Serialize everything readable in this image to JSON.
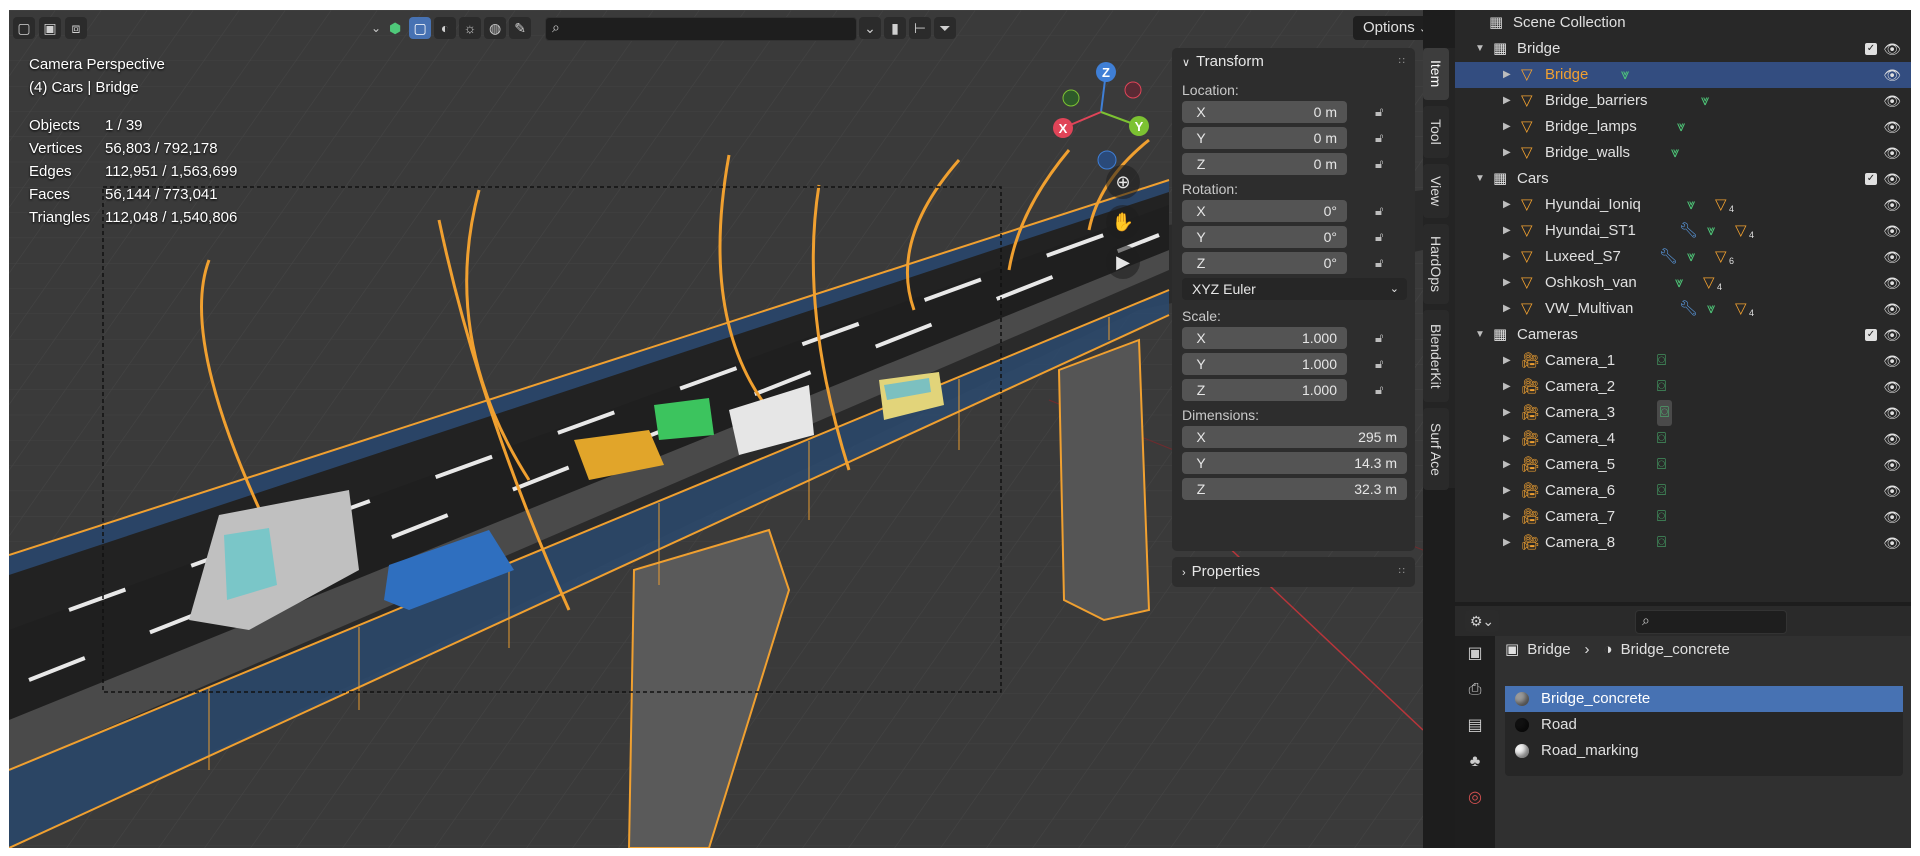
{
  "viewport": {
    "mode_label": "Camera Perspective",
    "collection_label": "(4) Cars | Bridge",
    "stats": [
      {
        "label": "Objects",
        "value": "1 / 39"
      },
      {
        "label": "Vertices",
        "value": "56,803 / 792,178"
      },
      {
        "label": "Edges",
        "value": "112,951 / 1,563,699"
      },
      {
        "label": "Faces",
        "value": "56,144 / 773,041"
      },
      {
        "label": "Triangles",
        "value": "112,048 / 1,540,806"
      }
    ],
    "options_label": "Options",
    "gizmo": {
      "x": "X",
      "y": "Y",
      "z": "Z"
    }
  },
  "npanel": {
    "transform_title": "Transform",
    "location_label": "Location:",
    "location": [
      {
        "axis": "X",
        "value": "0 m"
      },
      {
        "axis": "Y",
        "value": "0 m"
      },
      {
        "axis": "Z",
        "value": "0 m"
      }
    ],
    "rotation_label": "Rotation:",
    "rotation": [
      {
        "axis": "X",
        "value": "0°"
      },
      {
        "axis": "Y",
        "value": "0°"
      },
      {
        "axis": "Z",
        "value": "0°"
      }
    ],
    "rotation_mode": "XYZ Euler",
    "scale_label": "Scale:",
    "scale": [
      {
        "axis": "X",
        "value": "1.000"
      },
      {
        "axis": "Y",
        "value": "1.000"
      },
      {
        "axis": "Z",
        "value": "1.000"
      }
    ],
    "dimensions_label": "Dimensions:",
    "dimensions": [
      {
        "axis": "X",
        "value": "295 m"
      },
      {
        "axis": "Y",
        "value": "14.3 m"
      },
      {
        "axis": "Z",
        "value": "32.3 m"
      }
    ],
    "properties_title": "Properties"
  },
  "sidetabs": [
    "Item",
    "Tool",
    "View",
    "HardOps",
    "BlenderKit",
    "Surf Ace"
  ],
  "outliner": {
    "root": "Scene Collection",
    "rows": [
      {
        "name": "Bridge",
        "kind": "collection",
        "level": 1,
        "checked": true
      },
      {
        "name": "Bridge",
        "kind": "mesh",
        "level": 2,
        "selected": true,
        "extras": [
          "mesh-data"
        ]
      },
      {
        "name": "Bridge_barriers",
        "kind": "mesh",
        "level": 2,
        "extras": [
          "mesh-data"
        ]
      },
      {
        "name": "Bridge_lamps",
        "kind": "mesh",
        "level": 2,
        "extras": [
          "mesh-data"
        ]
      },
      {
        "name": "Bridge_walls",
        "kind": "mesh",
        "level": 2,
        "extras": [
          "mesh-data"
        ]
      },
      {
        "name": "Cars",
        "kind": "collection",
        "level": 1,
        "checked": true
      },
      {
        "name": "Hyundai_Ioniq",
        "kind": "mesh",
        "level": 2,
        "extras": [
          "mesh-data",
          "child-meshes"
        ],
        "count": "4"
      },
      {
        "name": "Hyundai_ST1",
        "kind": "mesh",
        "level": 2,
        "extras": [
          "modifier",
          "mesh-data",
          "child-meshes"
        ],
        "count": "4"
      },
      {
        "name": "Luxeed_S7",
        "kind": "mesh",
        "level": 2,
        "extras": [
          "modifier",
          "mesh-data",
          "child-meshes"
        ],
        "count": "6"
      },
      {
        "name": "Oshkosh_van",
        "kind": "mesh",
        "level": 2,
        "extras": [
          "mesh-data",
          "child-meshes"
        ],
        "count": "4"
      },
      {
        "name": "VW_Multivan",
        "kind": "mesh",
        "level": 2,
        "extras": [
          "modifier",
          "mesh-data",
          "child-meshes"
        ],
        "count": "4"
      },
      {
        "name": "Cameras",
        "kind": "collection",
        "level": 1,
        "checked": true
      },
      {
        "name": "Camera_1",
        "kind": "camera",
        "level": 2,
        "extras": [
          "camera-data"
        ]
      },
      {
        "name": "Camera_2",
        "kind": "camera",
        "level": 2,
        "extras": [
          "camera-data"
        ]
      },
      {
        "name": "Camera_3",
        "kind": "camera",
        "level": 2,
        "extras": [
          "camera-data-active"
        ]
      },
      {
        "name": "Camera_4",
        "kind": "camera",
        "level": 2,
        "extras": [
          "camera-data"
        ]
      },
      {
        "name": "Camera_5",
        "kind": "camera",
        "level": 2,
        "extras": [
          "camera-data"
        ]
      },
      {
        "name": "Camera_6",
        "kind": "camera",
        "level": 2,
        "extras": [
          "camera-data"
        ]
      },
      {
        "name": "Camera_7",
        "kind": "camera",
        "level": 2,
        "extras": [
          "camera-data"
        ]
      },
      {
        "name": "Camera_8",
        "kind": "camera",
        "level": 2,
        "extras": [
          "camera-data"
        ]
      }
    ]
  },
  "properties": {
    "breadcrumb_object": "Bridge",
    "breadcrumb_material": "Bridge_concrete",
    "materials": [
      {
        "name": "Bridge_concrete",
        "color": "#9a9a9a",
        "selected": true
      },
      {
        "name": "Road",
        "color": "#111111"
      },
      {
        "name": "Road_marking",
        "color": "#f2f2f2"
      }
    ]
  },
  "colors": {
    "accent": "#4772b3",
    "selected_row": "#334d80",
    "object_orange": "#f0a030",
    "mesh_green": "#4fc97a"
  }
}
